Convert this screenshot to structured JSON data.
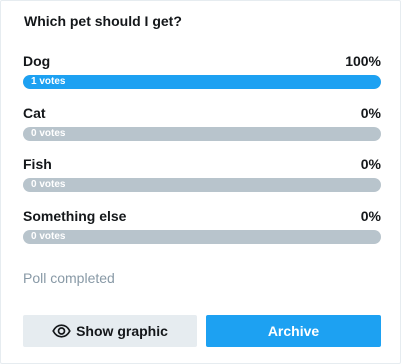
{
  "poll": {
    "question": "Which pet should I get?",
    "options": [
      {
        "label": "Dog",
        "percent": "100%",
        "votes": "1 votes",
        "fraction": 1.0
      },
      {
        "label": "Cat",
        "percent": "0%",
        "votes": "0 votes",
        "fraction": 0.0
      },
      {
        "label": "Fish",
        "percent": "0%",
        "votes": "0 votes",
        "fraction": 0.0
      },
      {
        "label": "Something else",
        "percent": "0%",
        "votes": "0 votes",
        "fraction": 0.0
      }
    ],
    "status": "Poll completed"
  },
  "actions": {
    "show_graphic_label": "Show graphic",
    "show_graphic_icon": "eye-icon",
    "archive_label": "Archive"
  },
  "colors": {
    "accent": "#1da1f2",
    "bar_empty": "#b8c4cc",
    "button_secondary_bg": "#e6ecf0",
    "muted_text": "#8899a6"
  }
}
